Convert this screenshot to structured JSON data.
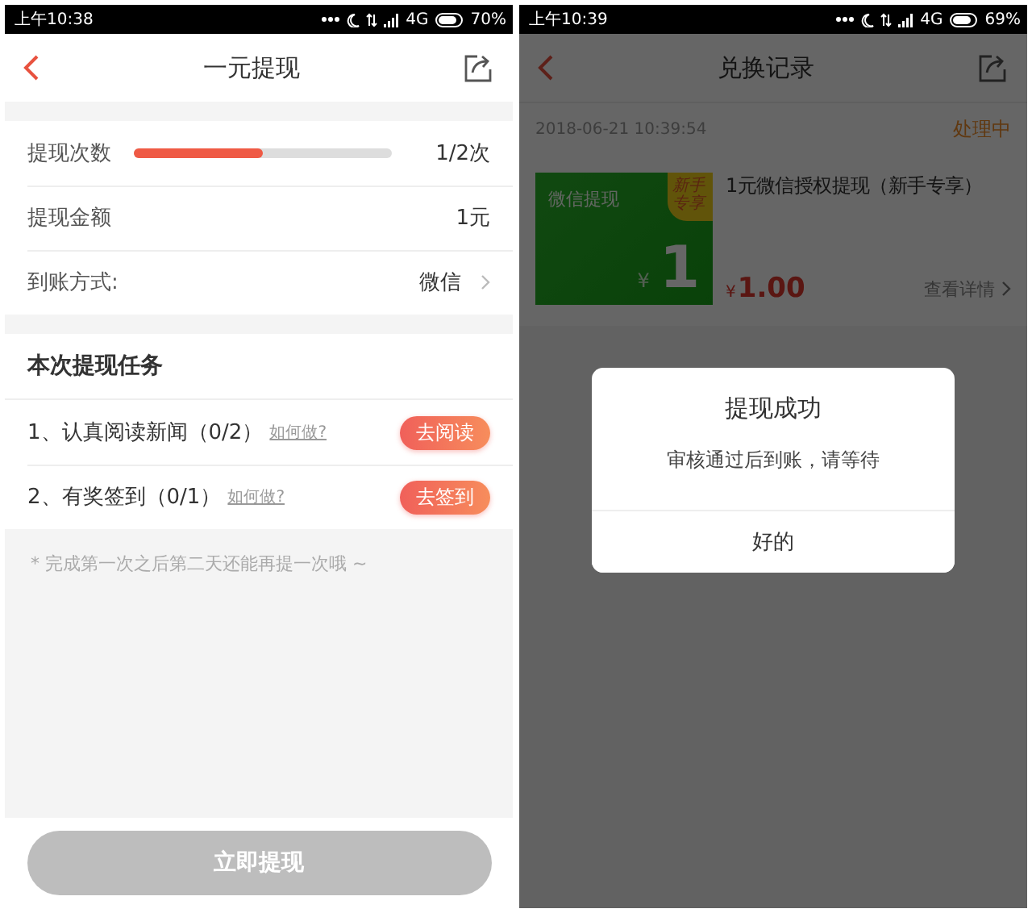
{
  "withdraw_screen": {
    "status_bar": {
      "time": "上午10:38",
      "network": "4G",
      "battery": "70%"
    },
    "header": {
      "title": "一元提现"
    },
    "progress_row": {
      "label": "提现次数",
      "level": 0.5,
      "value": "1/2次"
    },
    "amount_row": {
      "label": "提现金额",
      "value": "1元"
    },
    "method_row": {
      "label": "到账方式:",
      "value": "微信"
    },
    "tasks": {
      "title": "本次提现任务",
      "items": [
        {
          "text": "1、认真阅读新闻（0/2）",
          "help": "如何做?",
          "action": "去阅读"
        },
        {
          "text": "2、有奖签到（0/1）",
          "help": "如何做?",
          "action": "去签到"
        }
      ]
    },
    "note": "* 完成第一次之后第二天还能再提一次哦 ~",
    "submit": {
      "label": "立即提现",
      "disabled": true
    }
  },
  "records_screen": {
    "status_bar": {
      "time": "上午10:39",
      "network": "4G",
      "battery": "69%"
    },
    "header": {
      "title": "兑换记录"
    },
    "record": {
      "time": "2018-06-21 10:39:54",
      "status": "处理中",
      "card": {
        "label": "微信提现",
        "badge": "新手专享",
        "currency": "¥",
        "amount": "1"
      },
      "title": "1元微信授权提现（新手专享）",
      "price_currency": "¥",
      "price": "1.00",
      "detail": "查看详情"
    },
    "dialog": {
      "title": "提现成功",
      "message": "审核通过后到账，请等待",
      "button": "好的"
    }
  }
}
